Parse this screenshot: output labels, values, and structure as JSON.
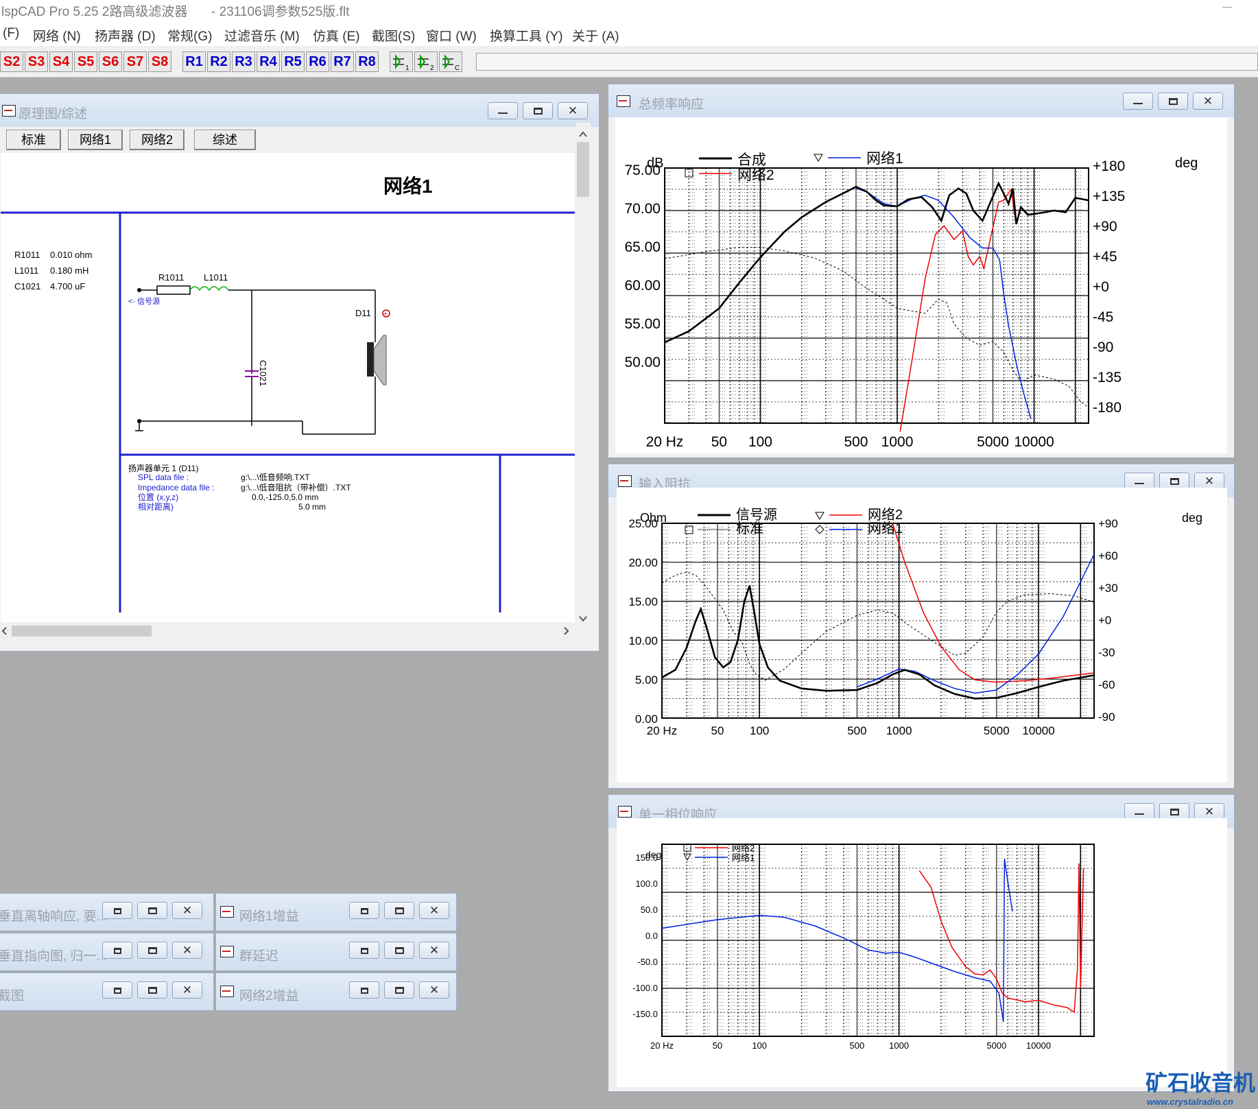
{
  "window": {
    "title": "lspCAD Pro 5.25 2路高级滤波器",
    "file": "- 231106调参数525版.flt"
  },
  "menu": [
    "(F)",
    "网络 (N)",
    "扬声器 (D)",
    "常规(G)",
    "过滤音乐 (M)",
    "仿真 (E)",
    "截图(S)",
    "窗口 (W)",
    "换算工具 (Y)",
    "关于 (A)"
  ],
  "toolbar": {
    "s": [
      "S2",
      "S3",
      "S4",
      "S5",
      "S6",
      "S7",
      "S8"
    ],
    "r": [
      "R1",
      "R2",
      "R3",
      "R4",
      "R5",
      "R6",
      "R7",
      "R8"
    ]
  },
  "schematic": {
    "title": "原理图/综述",
    "tabs": [
      "标准",
      "网络1",
      "网络2",
      "综述"
    ],
    "heading": "网络1",
    "components": [
      {
        "name": "R1011",
        "value": "0.010 ohm"
      },
      {
        "name": "L1011",
        "value": "0.180 mH"
      },
      {
        "name": "C1021",
        "value": "4.700 uF"
      }
    ],
    "labels": {
      "r": "R1011",
      "l": "L1011",
      "c": "C1021",
      "d": "D11",
      "src": "<- 信号源"
    },
    "driver": {
      "title": "扬声器单元 1 (D11)",
      "rows": [
        [
          "SPL data file :",
          "g:\\...\\低音频响.TXT"
        ],
        [
          "Impedance data file :",
          "g:\\...\\低音阻抗（带补偿）.TXT"
        ],
        [
          "位置 (x,y,z)",
          "0.0,-125.0,5.0 mm"
        ],
        [
          "相对距离)",
          "5.0 mm"
        ]
      ]
    }
  },
  "freq": {
    "title": "总频率响应",
    "legend": [
      "合成",
      "网络2",
      "网络1"
    ],
    "yunit": "dB",
    "y2unit": "deg",
    "yticks": [
      "75.00",
      "70.00",
      "65.00",
      "60.00",
      "55.00",
      "50.00"
    ],
    "y2ticks": [
      "+180",
      "+135",
      "+90",
      "+45",
      "+0",
      "-45",
      "-90",
      "-135",
      "-180"
    ],
    "xticks": [
      "20 Hz",
      "50",
      "100",
      "500",
      "1000",
      "5000",
      "10000"
    ]
  },
  "imp": {
    "title": "输入阻抗",
    "legend": [
      "信号源",
      "标准",
      "网络2",
      "网络1"
    ],
    "yunit": "Ohm",
    "y2unit": "deg",
    "yticks": [
      "25.00",
      "20.00",
      "15.00",
      "10.00",
      "5.00",
      "0.00"
    ],
    "y2ticks": [
      "+90",
      "+60",
      "+30",
      "+0",
      "-30",
      "-60",
      "-90"
    ],
    "xticks": [
      "20 Hz",
      "50",
      "100",
      "500",
      "1000",
      "5000",
      "10000"
    ]
  },
  "phase": {
    "title": "单一相位响应",
    "legend": [
      "网络2",
      "网络1"
    ],
    "yunit": "deg",
    "yticks": [
      "150.0",
      "100.0",
      "50.0",
      "0.0",
      "-50.0",
      "-100.0",
      "-150.0"
    ],
    "xticks": [
      "20 Hz",
      "50",
      "100",
      "500",
      "1000",
      "5000",
      "10000"
    ]
  },
  "minimized": [
    "垂直离轴响应, 要...",
    "网络1增益",
    "垂直指向图, 归一...",
    "群延迟",
    "截图",
    "网络2增益"
  ],
  "logo": {
    "main": "矿石收音机",
    "url": "www.crystalradio.cn"
  }
}
